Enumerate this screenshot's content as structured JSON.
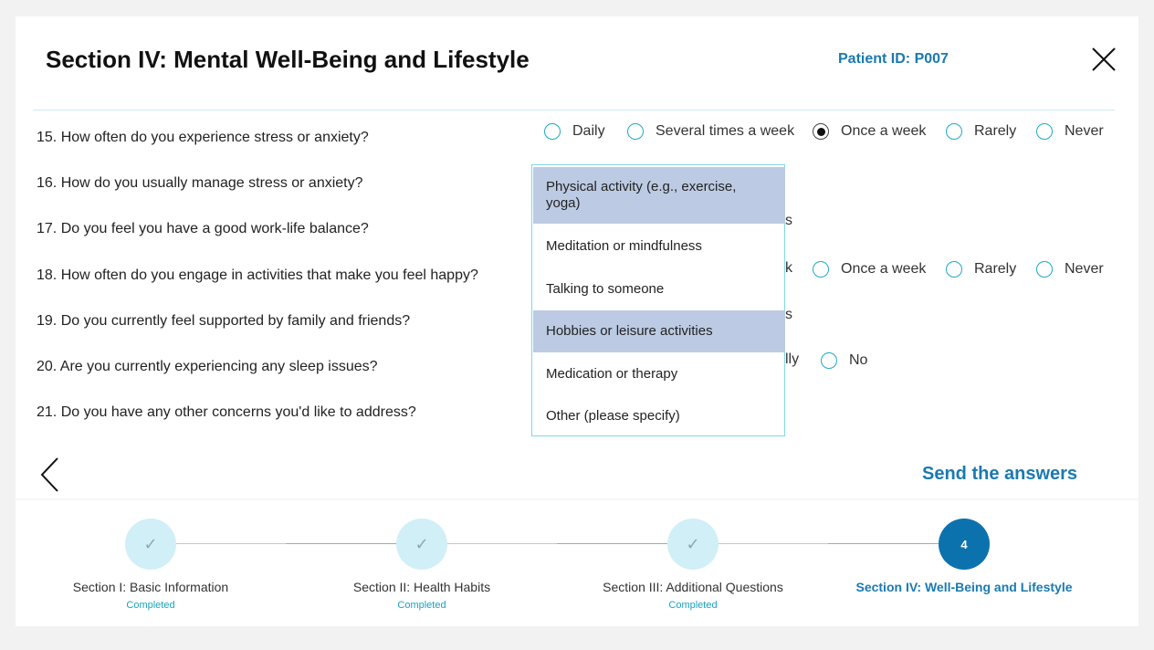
{
  "header": {
    "title": "Section IV: Mental Well-Being and Lifestyle",
    "patient_id": "Patient ID: P007"
  },
  "questions": [
    "15. How often do you experience stress or anxiety?",
    "16. How do you usually manage stress or anxiety?",
    "17. Do you feel you have a good work-life balance?",
    "18. How often do you engage in activities that make you feel happy?",
    "19. Do you currently feel supported by family and friends?",
    "20. Are you currently experiencing any sleep issues?",
    "21. Do you have any other concerns you'd like to address?"
  ],
  "q15_options": [
    {
      "label": "Daily",
      "selected": false
    },
    {
      "label": "Several times a week",
      "selected": false
    },
    {
      "label": "Once a week",
      "selected": true
    },
    {
      "label": "Rarely",
      "selected": false
    },
    {
      "label": "Never",
      "selected": false
    }
  ],
  "q18_partial": {
    "cut_label": "k",
    "options": [
      {
        "label": "Once a week",
        "selected": false
      },
      {
        "label": "Rarely",
        "selected": false
      },
      {
        "label": "Never",
        "selected": false
      }
    ]
  },
  "q19_partial": {
    "cut_label": "s"
  },
  "q17_partial": {
    "cut_label": "s"
  },
  "q20_partial": {
    "cut_label": "lly",
    "options": [
      {
        "label": "No",
        "selected": false
      }
    ]
  },
  "dropdown": {
    "items": [
      {
        "label": "Physical activity (e.g., exercise, yoga)",
        "highlighted": true
      },
      {
        "label": "Meditation or mindfulness",
        "highlighted": false
      },
      {
        "label": "Talking to someone",
        "highlighted": false
      },
      {
        "label": "Hobbies or leisure activities",
        "highlighted": true
      },
      {
        "label": "Medication or therapy",
        "highlighted": false
      },
      {
        "label": "Other (please specify)",
        "highlighted": false
      }
    ]
  },
  "nav": {
    "send_label": "Send the answers"
  },
  "steps": [
    {
      "name": "Section I: Basic Information",
      "status": "Completed",
      "marker": "✓",
      "state": "done"
    },
    {
      "name": "Section II: Health Habits",
      "status": "Completed",
      "marker": "✓",
      "state": "done"
    },
    {
      "name": "Section III: Additional Questions",
      "status": "Completed",
      "marker": "✓",
      "state": "done"
    },
    {
      "name": "Section IV: Well-Being and Lifestyle",
      "status": "",
      "marker": "4",
      "state": "active"
    }
  ],
  "colors": {
    "accent": "#1a7ab0",
    "radio_border": "#20a8c6",
    "highlight": "#bccbe3",
    "step_done": "#d1eff6",
    "step_active": "#0c72ae"
  }
}
